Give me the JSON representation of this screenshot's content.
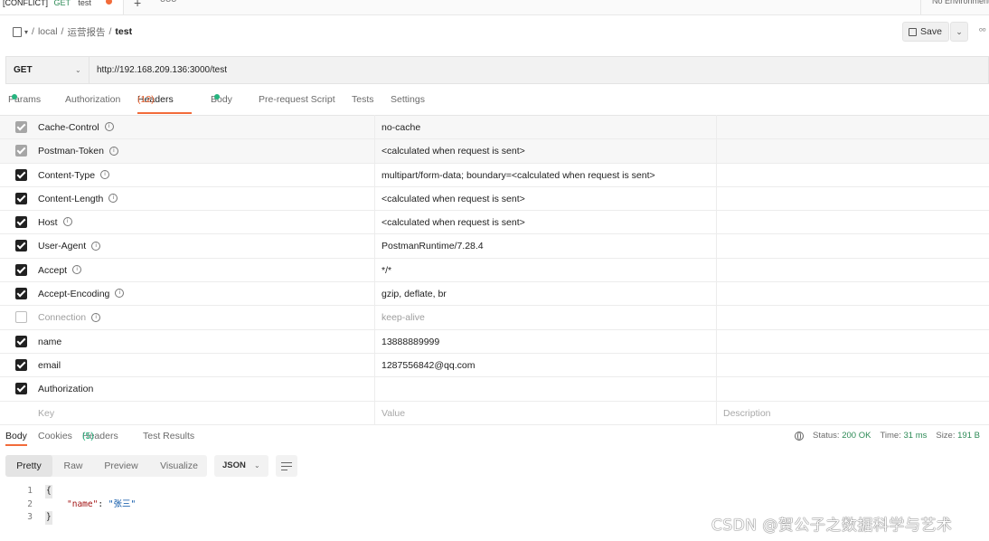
{
  "top_bar": {
    "tab_conflict": "[CONFLICT]",
    "tab_method": "GET",
    "tab_name": "test",
    "plus": "+",
    "more": "ooo",
    "environment": "No Environment"
  },
  "breadcrumb": {
    "items": [
      "local",
      "运营报告"
    ],
    "current": "test"
  },
  "save": {
    "label": "Save"
  },
  "request": {
    "method": "GET",
    "url": "http://192.168.209.136:3000/test"
  },
  "request_tabs": {
    "params": "Params",
    "authorization": "Authorization",
    "headers": "Headers",
    "headers_count": "(12)",
    "body": "Body",
    "prerequest": "Pre-request Script",
    "tests": "Tests",
    "settings": "Settings"
  },
  "headers": [
    {
      "key": "Cache-Control",
      "value": "no-cache",
      "state": "grey",
      "info": true
    },
    {
      "key": "Postman-Token",
      "value": "<calculated when request is sent>",
      "state": "grey",
      "info": true
    },
    {
      "key": "Content-Type",
      "value": "multipart/form-data; boundary=<calculated when request is sent>",
      "state": "on",
      "info": true
    },
    {
      "key": "Content-Length",
      "value": "<calculated when request is sent>",
      "state": "on",
      "info": true
    },
    {
      "key": "Host",
      "value": "<calculated when request is sent>",
      "state": "on",
      "info": true
    },
    {
      "key": "User-Agent",
      "value": "PostmanRuntime/7.28.4",
      "state": "on",
      "info": true
    },
    {
      "key": "Accept",
      "value": "*/*",
      "state": "on",
      "info": true
    },
    {
      "key": "Accept-Encoding",
      "value": "gzip, deflate, br",
      "state": "on",
      "info": true
    },
    {
      "key": "Connection",
      "value": "keep-alive",
      "state": "off",
      "info": true
    },
    {
      "key": "name",
      "value": "13888889999",
      "state": "on",
      "info": false
    },
    {
      "key": "email",
      "value": "1287556842@qq.com",
      "state": "on",
      "info": false
    },
    {
      "key": "Authorization",
      "value": "",
      "state": "on",
      "info": false
    }
  ],
  "placeholder_row": {
    "key": "Key",
    "value": "Value",
    "description": "Description"
  },
  "info_glyph": "i",
  "response_tabs": {
    "body": "Body",
    "cookies": "Cookies",
    "headers": "Headers",
    "headers_count": "(5)",
    "test_results": "Test Results"
  },
  "status": {
    "status_label": "Status:",
    "status_value": "200 OK",
    "time_label": "Time:",
    "time_value": "31 ms",
    "size_label": "Size:",
    "size_value": "191 B"
  },
  "view_modes": {
    "pretty": "Pretty",
    "raw": "Raw",
    "preview": "Preview",
    "visualize": "Visualize",
    "format": "JSON"
  },
  "response_body": {
    "line_numbers": [
      "1",
      "2",
      "3"
    ],
    "open_brace": "{",
    "key": "\"name\"",
    "colon": ": ",
    "value": "\"张三\"",
    "close_brace": "}"
  },
  "watermark": "CSDN @贺公子之数据科学与艺术",
  "colors": {
    "accent": "#f26b3a",
    "status_green": "#26b47f"
  }
}
